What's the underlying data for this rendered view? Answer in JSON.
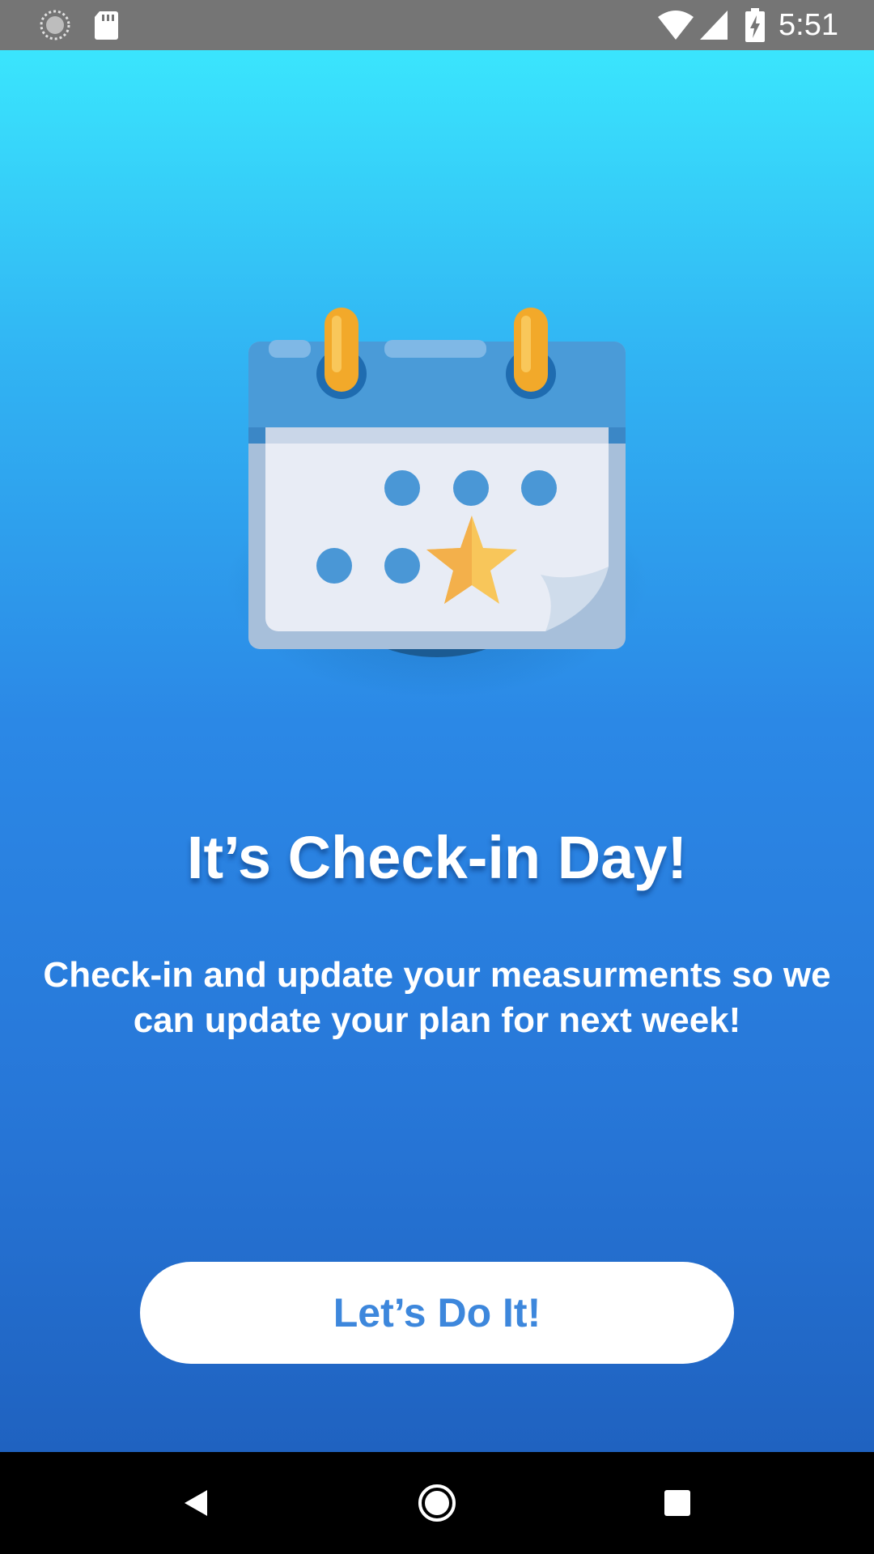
{
  "status_bar": {
    "time": "5:51",
    "left_icons": [
      "sync-icon",
      "sd-card-icon"
    ],
    "right_icons": [
      "wifi-icon",
      "cellular-signal-icon",
      "battery-charging-icon"
    ]
  },
  "main": {
    "illustration": "calendar-star-icon",
    "title": "It’s Check-in Day!",
    "subtitle": "Check-in and update your measurments so we can update your plan for next week!",
    "cta_label": "Let’s Do It!"
  },
  "nav_bar": {
    "buttons": [
      "back-icon",
      "home-icon",
      "recents-icon"
    ]
  },
  "colors": {
    "status_bar": "#757575",
    "gradient_top": "#3ae5fd",
    "gradient_bottom": "#1f62c0",
    "button_text": "#3d87dc",
    "calendar_header": "#4a9bd8",
    "calendar_dots": "#4a97d6",
    "star": "#f8c65a",
    "rings": "#f2a92a"
  }
}
